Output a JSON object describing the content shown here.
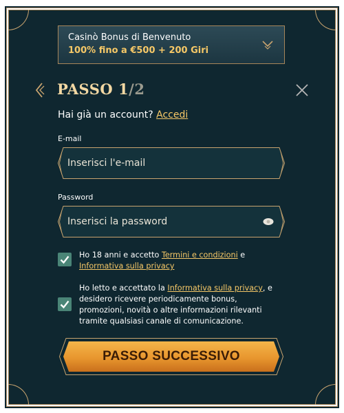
{
  "bonus": {
    "title": "Casinò Bonus di Benvenuto",
    "subtitle": "100% fino a €500 + 200 Giri"
  },
  "header": {
    "step_prefix": "PASSO 1",
    "step_total": "/2"
  },
  "login_prompt": {
    "text": "Hai già un account? ",
    "link": "Accedi"
  },
  "email": {
    "label": "E-mail",
    "placeholder": "Inserisci l'e-mail",
    "value": ""
  },
  "password": {
    "label": "Password",
    "placeholder": "Inserisci la password",
    "value": ""
  },
  "consent_terms": {
    "checked": true,
    "text_before": "Ho 18 anni e accetto ",
    "link1": "Termini e condizioni",
    "text_mid": " e",
    "link2": "Informativa sulla privacy"
  },
  "consent_marketing": {
    "checked": true,
    "text_before": "Ho letto e accettato la ",
    "link": "Informativa sulla privacy",
    "text_after": ", e desidero ricevere periodicamente bonus, promozioni, novità o altre informazioni rilevanti tramite qualsiasi canale di comunicazione."
  },
  "submit": {
    "label": "PASSO SUCCESSIVO"
  },
  "colors": {
    "panel": "#0f2730",
    "gold": "#c9a46f",
    "accent_text": "#f6c867",
    "checkbox": "#4a8577",
    "button_orange": "#e8962e"
  },
  "icons": {
    "bonus_dropdown": "chevron-down-icon",
    "back": "back-arrow-icon",
    "close": "close-icon",
    "password_visibility": "eye-icon",
    "checkbox_mark": "checkmark-icon"
  }
}
